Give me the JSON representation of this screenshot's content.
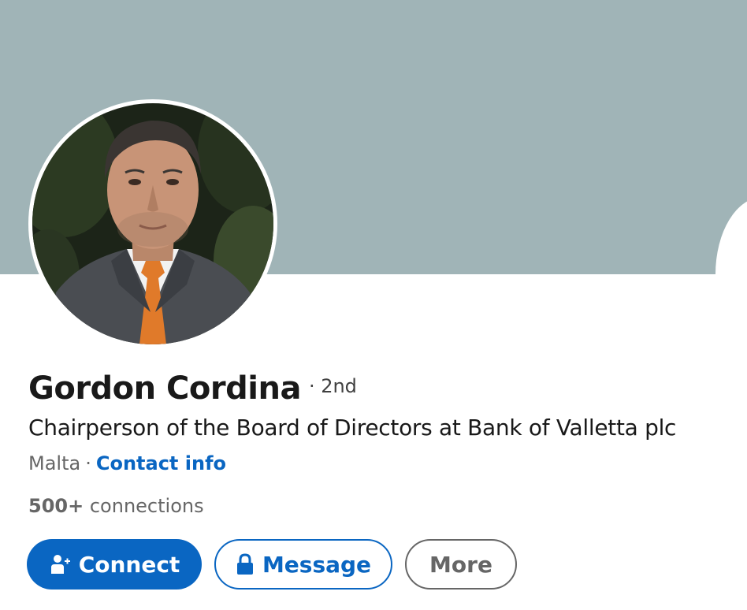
{
  "profile": {
    "name": "Gordon Cordina",
    "degree": "· 2nd",
    "headline": "Chairperson of the Board of Directors at Bank of Valletta plc",
    "location": "Malta",
    "separator": "·",
    "contact_info_label": "Contact info",
    "connections_count": "500+",
    "connections_label": "connections"
  },
  "actions": {
    "connect_label": "Connect",
    "message_label": "Message",
    "more_label": "More"
  },
  "icons": {
    "connect": "add-person-icon",
    "message": "lock-icon"
  },
  "colors": {
    "banner": "#a0b4b7",
    "primary": "#0a66c2",
    "text_primary": "#191919",
    "text_secondary": "#666666"
  }
}
